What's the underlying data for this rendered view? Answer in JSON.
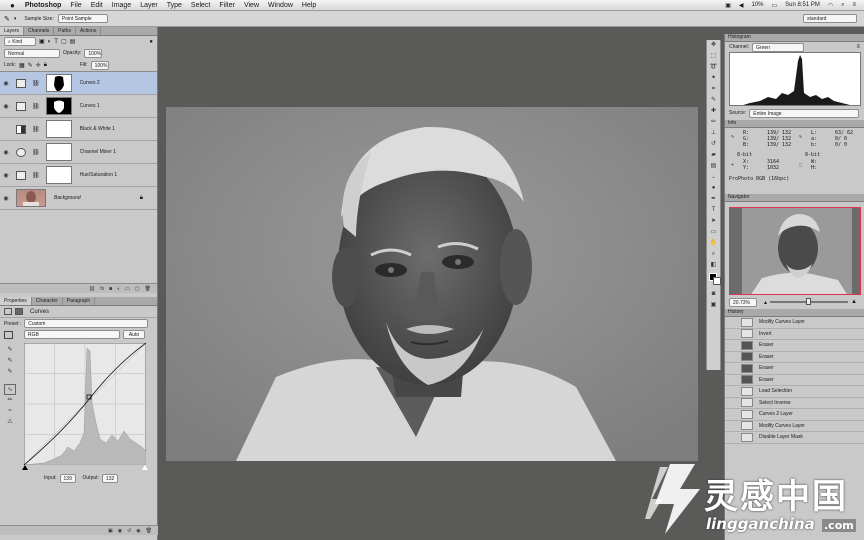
{
  "menubar": {
    "apple": "",
    "app": "Photoshop",
    "items": [
      "File",
      "Edit",
      "Image",
      "Layer",
      "Type",
      "Select",
      "Filter",
      "View",
      "Window",
      "Help"
    ],
    "battery": "10%",
    "date": "Sun 8:51 PM"
  },
  "options": {
    "sample_label": "Sample Size:",
    "sample_value": "Point Sample",
    "workspace": "standard"
  },
  "layers_panel": {
    "tabs": [
      "Layers",
      "Channels",
      "Paths",
      "Actions"
    ],
    "kind": "Kind",
    "blend": "Normal",
    "opacity_label": "Opacity:",
    "opacity": "100%",
    "lock_label": "Lock:",
    "fill_label": "Fill:",
    "fill": "100%",
    "layers": [
      {
        "name": "Curves 2",
        "selected": true
      },
      {
        "name": "Curves 1",
        "selected": false
      },
      {
        "name": "Black & White 1",
        "selected": false
      },
      {
        "name": "Channel Mixer 1",
        "selected": false
      },
      {
        "name": "Hue/Saturation 1",
        "selected": false
      },
      {
        "name": "Background",
        "selected": false
      }
    ]
  },
  "properties_panel": {
    "tabs": [
      "Properties",
      "Character",
      "Paragraph"
    ],
    "title": "Curves",
    "preset_label": "Preset :",
    "preset": "Custom",
    "channel": "RGB",
    "auto": "Auto",
    "input_label": "Input:",
    "input": "139",
    "output_label": "Output:",
    "output": "132"
  },
  "histogram_panel": {
    "title": "Histogram",
    "channel_label": "Channel:",
    "channel": "Green",
    "source_label": "Source:",
    "source": "Entire Image"
  },
  "info_panel": {
    "title": "Info",
    "r": "R:",
    "r_val": "139/ 132",
    "g": "G:",
    "g_val": "139/ 132",
    "b": "B:",
    "b_val": "139/ 132",
    "l": "L:",
    "l_val": "63/ 62",
    "a": "a:",
    "a_val": "0/ 0",
    "b2": "b:",
    "b2_val": "0/ 0",
    "bit1": "8-bit",
    "bit2": "8-bit",
    "x": "X:",
    "x_val": "3164",
    "y": "Y:",
    "y_val": "1032",
    "w": "W:",
    "h": "H:",
    "profile": "ProPhoto RGB (16bpc)"
  },
  "navigator_panel": {
    "title": "Navigator",
    "zoom": "20.73%"
  },
  "history_panel": {
    "title": "History",
    "items": [
      "Modify Curves Layer",
      "Invert",
      "Eraser",
      "Eraser",
      "Eraser",
      "Eraser",
      "Load Selection",
      "Select Inverse",
      "Curves 2 Layer",
      "Modify Curves Layer",
      "Disable Layer Mask"
    ]
  },
  "watermark": {
    "cn": "灵感中国",
    "en": "lingganchina",
    "com": ".com"
  },
  "colors": {
    "selection": "#b5c6e2",
    "nav_frame": "#e0344c"
  }
}
